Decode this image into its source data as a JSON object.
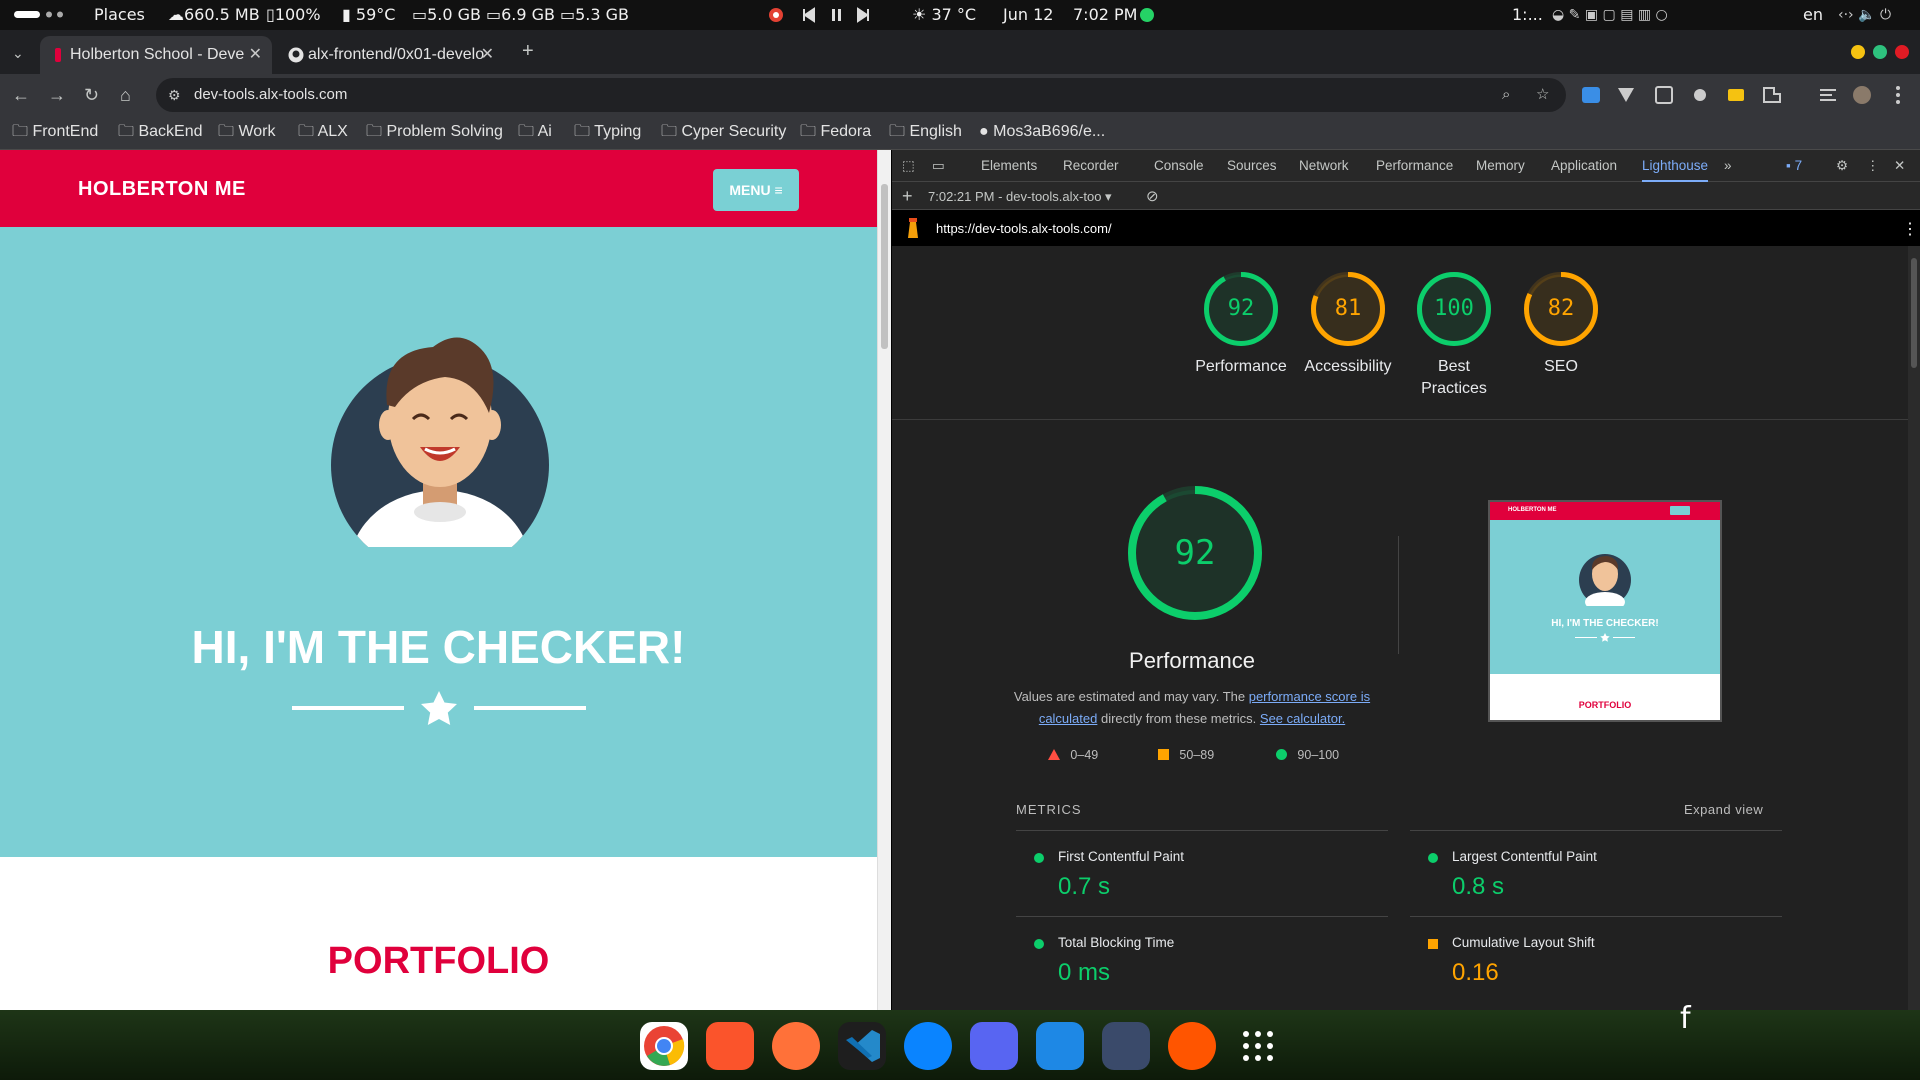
{
  "topbar": {
    "places": "Places",
    "memory": "660.5 MB",
    "battery": "100%",
    "cpu_temp": "59°C",
    "disk1": "5.0 GB",
    "disk2": "6.9 GB",
    "disk3": "5.3 GB",
    "weather": "37 °C",
    "date": "Jun 12",
    "time": "7:02 PM",
    "workspace": "1:...",
    "lang": "en"
  },
  "browser": {
    "tabs": [
      {
        "label": "Holberton School - Deve"
      },
      {
        "label": "alx-frontend/0x01-develo"
      }
    ],
    "url": "dev-tools.alx-tools.com",
    "bookmarks": [
      "FrontEnd",
      "BackEnd",
      "Work",
      "ALX",
      "Problem Solving",
      "Ai",
      "Typing",
      "Cyper Security",
      "Fedora",
      "English",
      "Mos3aB696/e..."
    ]
  },
  "page": {
    "logo": "HOLBERTON ME",
    "menu": "MENU",
    "hero_title": "HI, I'M THE CHECKER!",
    "portfolio": "PORTFOLIO"
  },
  "devtools": {
    "tabs": [
      "Elements",
      "Recorder",
      "Console",
      "Sources",
      "Network",
      "Performance",
      "Memory",
      "Application",
      "Lighthouse"
    ],
    "active_tab": "Lighthouse",
    "issues_count": "7",
    "report_selector": "7:02:21 PM - dev-tools.alx-too",
    "report_url": "https://dev-tools.alx-tools.com/"
  },
  "lighthouse": {
    "scores": [
      {
        "label": "Performance",
        "value": 92
      },
      {
        "label": "Accessibility",
        "value": 81
      },
      {
        "label": "Best Practices",
        "value": 100
      },
      {
        "label": "SEO",
        "value": 82
      }
    ],
    "big_score": "92",
    "big_label": "Performance",
    "disclaimer_pre": "Values are estimated and may vary. The ",
    "disclaimer_link1": "performance score is calculated",
    "disclaimer_mid": " directly from these metrics. ",
    "disclaimer_link2": "See calculator.",
    "legend": [
      "0–49",
      "50–89",
      "90–100"
    ],
    "metrics_heading": "METRICS",
    "expand_view": "Expand view",
    "metrics": [
      {
        "name": "First Contentful Paint",
        "value": "0.7 s",
        "status": "good"
      },
      {
        "name": "Largest Contentful Paint",
        "value": "0.8 s",
        "status": "good"
      },
      {
        "name": "Total Blocking Time",
        "value": "0 ms",
        "status": "good"
      },
      {
        "name": "Cumulative Layout Shift",
        "value": "0.16",
        "status": "average"
      }
    ],
    "thumb_logo": "HOLBERTON ME",
    "thumb_title": "HI, I'M THE CHECKER!",
    "thumb_portfolio": "PORTFOLIO",
    "colors": {
      "good": "#0cce6b",
      "average": "#ffa400",
      "poor": "#ff4e42"
    }
  }
}
